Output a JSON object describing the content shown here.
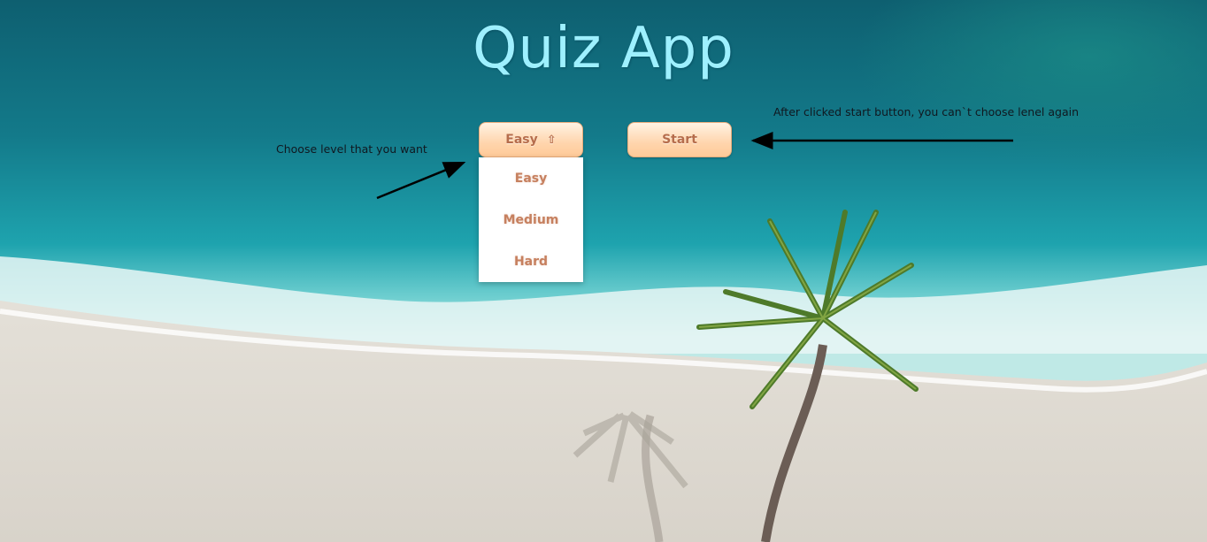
{
  "app": {
    "title": "Quiz App"
  },
  "controls": {
    "level_button_label": "Easy",
    "level_button_icon": "⇧",
    "start_button_label": "Start"
  },
  "dropdown": {
    "items": [
      {
        "label": "Easy"
      },
      {
        "label": "Medium"
      },
      {
        "label": "Hard"
      }
    ]
  },
  "annotations": {
    "left_note": "Choose level that you want",
    "right_note": "After clicked start button, you can`t choose lenel again"
  },
  "colors": {
    "title": "#9ef0ff",
    "button_text": "#b66d4c",
    "button_bg": "#ffd5ad",
    "dropdown_text": "#c6805f"
  }
}
